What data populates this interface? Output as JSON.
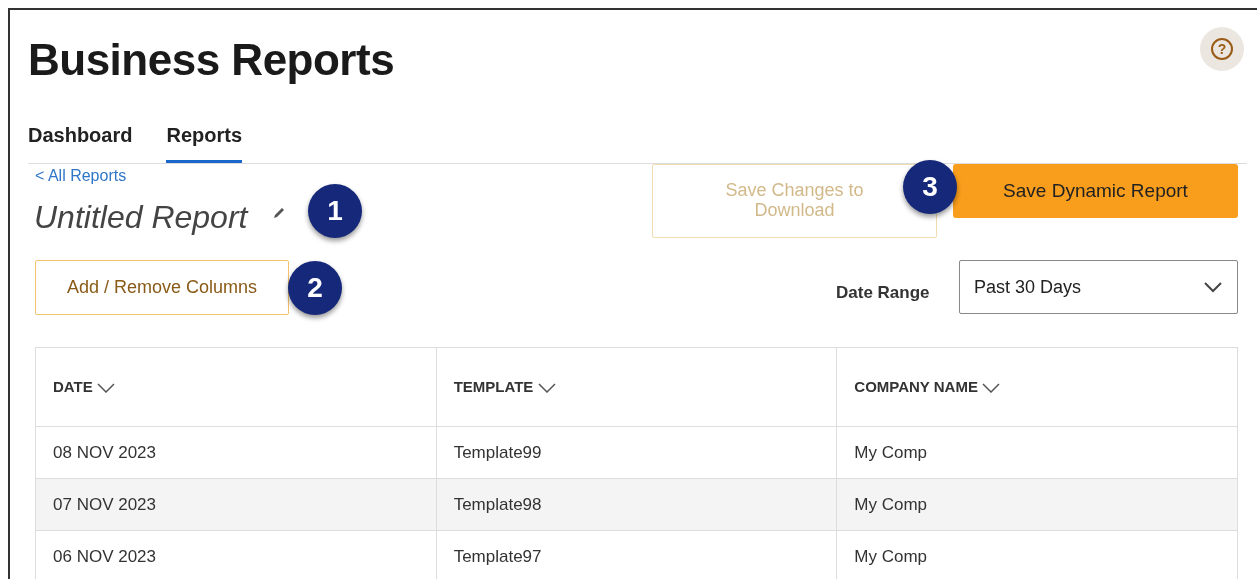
{
  "header": {
    "title": "Business Reports",
    "help_button": {
      "label": "?"
    }
  },
  "tabs": [
    {
      "label": "Dashboard",
      "selected": false
    },
    {
      "label": "Reports",
      "selected": true
    }
  ],
  "back_link": "< All Reports",
  "report_title": "Untitled Report",
  "buttons": {
    "save_changes": {
      "label": "Save Changes to Download",
      "disabled": true
    },
    "save_dynamic": {
      "label": "Save Dynamic Report",
      "disabled": false
    },
    "columns": {
      "label": "Add / Remove Columns"
    }
  },
  "date_range": {
    "label": "Date Range",
    "value": "Past 30 Days"
  },
  "callouts": [
    "1",
    "2",
    "3"
  ],
  "table": {
    "columns": [
      "DATE",
      "TEMPLATE",
      "COMPANY NAME"
    ],
    "rows": [
      [
        "08 NOV 2023",
        "Template99",
        "My Comp"
      ],
      [
        "07 NOV 2023",
        "Template98",
        "My Comp"
      ],
      [
        "06 NOV 2023",
        "Template97",
        "My Comp"
      ]
    ]
  }
}
